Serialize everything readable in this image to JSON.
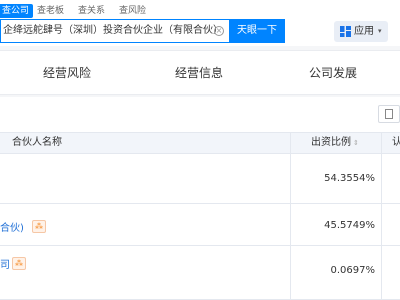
{
  "header": {
    "tabs": [
      "查公司",
      "查老板",
      "查关系",
      "查风险"
    ],
    "search_value": "企绛远舵肆号（深圳）投资合伙企业（有限合伙）",
    "search_button": "天眼一下",
    "app_menu": {
      "label": "应用",
      "caret": "▾"
    }
  },
  "subnav": {
    "items": [
      "经营风险",
      "经营信息",
      "公司发展"
    ]
  },
  "table": {
    "headers": {
      "partner_name": "合伙人名称",
      "ratio": "出资比例",
      "ratio_sort": "⇕",
      "cut": "认"
    },
    "rows": [
      {
        "name": "",
        "ratio": "54.3554%"
      },
      {
        "name": "合伙)",
        "ratio": "45.5749%"
      },
      {
        "name": "司",
        "ratio": "0.0697%"
      }
    ]
  },
  "colors": {
    "accent": "#0084ff",
    "link": "#1f6fd6",
    "graph_icon": "#f5861f"
  }
}
